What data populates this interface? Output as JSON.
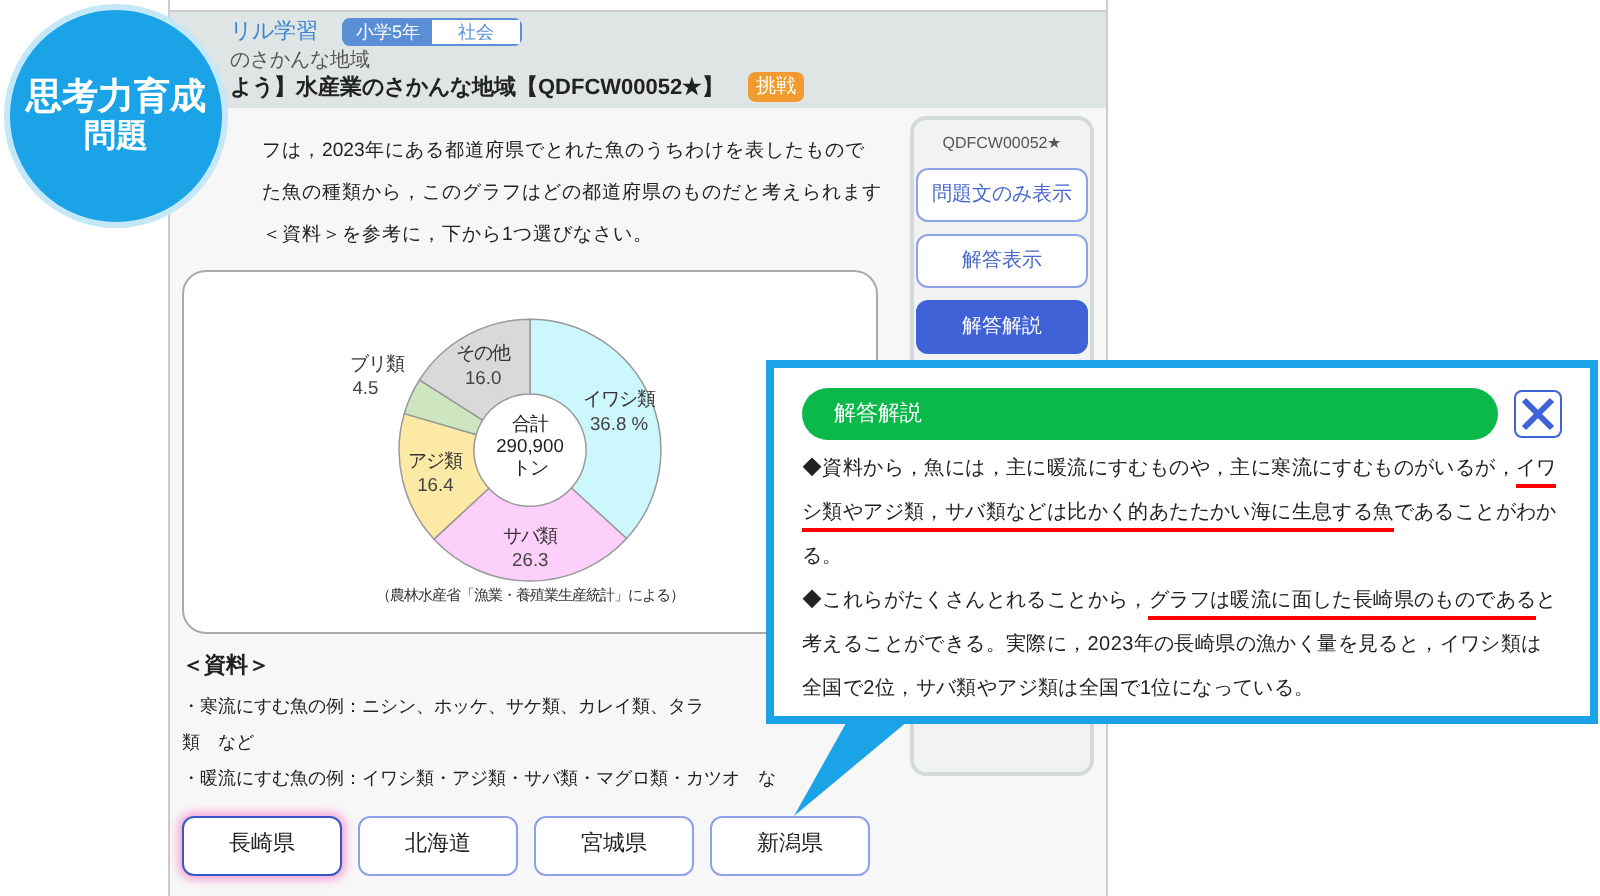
{
  "badge": {
    "lines": [
      "思考力育成",
      "問題"
    ]
  },
  "header": {
    "app_name": "リル学習",
    "tags": [
      {
        "label": "小学5年",
        "selected": true
      },
      {
        "label": "社会",
        "selected": false
      }
    ],
    "subtitle": "のさかんな地域",
    "title": "よう】水産業のさかんな地域【QDFCW00052★】",
    "level_badge": "挑戦"
  },
  "question": [
    "フは，2023年にある都道府県でとれた魚のうちわけを表したもので",
    "た魚の種類から，このグラフはどの都道府県のものだと考えられます",
    "＜資料＞を参考に，下から1つ選びなさい。"
  ],
  "chart": {
    "center_label": [
      "合計",
      "290,900",
      "トン"
    ],
    "source": "（農林水産省「漁業・養殖業生産統計」による）",
    "chart_data": {
      "type": "donut",
      "categories": [
        "イワシ類",
        "サバ類",
        "アジ類",
        "ブリ類",
        "その他"
      ],
      "series": [
        {
          "values": [
            36.8,
            26.3,
            16.4,
            4.5,
            16.0
          ]
        }
      ],
      "colors": [
        "#ccf8fd",
        "#fcd0fb",
        "#fbe9a5",
        "#cde6c0",
        "#d9d9d9"
      ],
      "value_labels": [
        "36.8 %",
        "26.3",
        "16.4",
        "4.5",
        "16.0"
      ]
    }
  },
  "material": {
    "heading": "＜資料＞",
    "lines": [
      "・寒流にすむ魚の例：ニシン、ホッケ、サケ類、カレイ類、タラ",
      "類　など",
      "・暖流にすむ魚の例：イワシ類・アジ類・サバ類・マグロ類・カツオ　な"
    ]
  },
  "choices": [
    {
      "label": "長崎県",
      "selected": true
    },
    {
      "label": "北海道",
      "selected": false
    },
    {
      "label": "宮城県",
      "selected": false
    },
    {
      "label": "新潟県",
      "selected": false
    }
  ],
  "side_panel": {
    "code": "QDFCW00052★",
    "buttons": [
      {
        "label": "問題文のみ表示",
        "selected": false
      },
      {
        "label": "解答表示",
        "selected": false
      },
      {
        "label": "解答解説",
        "selected": true
      }
    ]
  },
  "explanation": {
    "title": "解答解説",
    "paragraphs": [
      [
        {
          "text": "◆資料から，魚には，主に暖流にすむものや，主に寒流にすむものがいるが，",
          "underline": false
        },
        {
          "text": "イワシ類やアジ類，サバ類などは比かく的あたたかい海に生息する魚",
          "underline": true
        },
        {
          "text": "であることがわかる。",
          "underline": false
        }
      ],
      [
        {
          "text": "◆これらがたくさんとれることから，",
          "underline": false
        },
        {
          "text": "グラフは暖流に面した長崎県のものである",
          "underline": true
        },
        {
          "text": "と考えることができる。実際に，2023年の長崎県の漁かく量を見ると，イワシ類は全国で2位，サバ類やアジ類は全国で1位になっている。",
          "underline": false
        }
      ]
    ]
  }
}
